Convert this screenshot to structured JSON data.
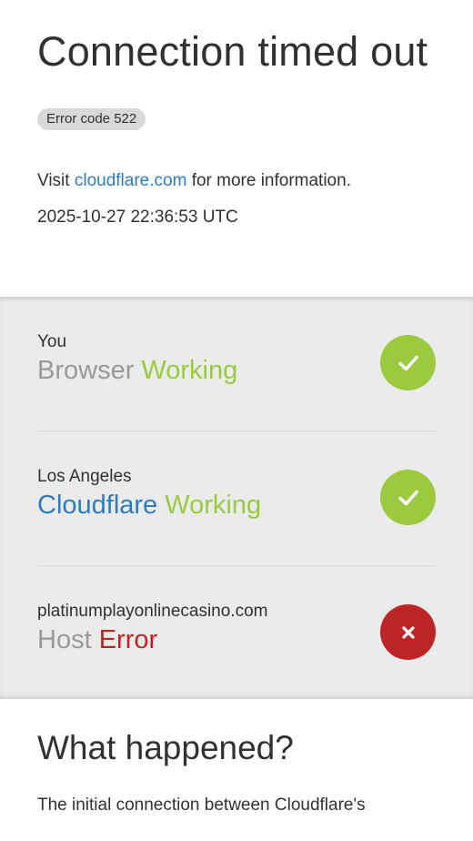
{
  "header": {
    "title": "Connection timed out",
    "error_badge": "Error code 522",
    "visit_prefix": "Visit",
    "visit_link": "cloudflare.com",
    "visit_suffix": "for more information.",
    "timestamp": "2025-10-27 22:36:53 UTC"
  },
  "status": [
    {
      "location": "You",
      "kind": "Browser",
      "state": "Working",
      "state_type": "ok",
      "icon": "check-icon"
    },
    {
      "location": "Los Angeles",
      "kind": "Cloudflare",
      "state": "Working",
      "state_type": "ok",
      "icon": "check-icon"
    },
    {
      "location": "platinumplayonlinecasino.com",
      "kind": "Host",
      "state": "Error",
      "state_type": "error",
      "icon": "close-icon"
    }
  ],
  "section": {
    "heading": "What happened?",
    "paragraph": "The initial connection between Cloudflare's"
  },
  "colors": {
    "ok": "#9bca3e",
    "error": "#bd2426",
    "link": "#2f7bbf",
    "status_bg": "#ebebeb"
  }
}
